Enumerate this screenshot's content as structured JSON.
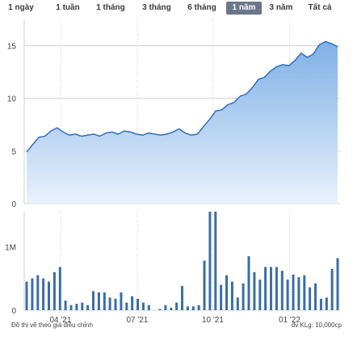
{
  "range_tabs": [
    {
      "label": "1 ngày",
      "active": false
    },
    {
      "label": "1 tuần",
      "active": false
    },
    {
      "label": "1 tháng",
      "active": false
    },
    {
      "label": "3 tháng",
      "active": false
    },
    {
      "label": "6 tháng",
      "active": false
    },
    {
      "label": "1 năm",
      "active": true
    },
    {
      "label": "3 năm",
      "active": false
    },
    {
      "label": "Tất cả",
      "active": false
    }
  ],
  "footer": {
    "left_note": "Đồ thị vẽ theo giá điều chỉnh",
    "right_note": "đv KLg: 10,000cp"
  },
  "colors": {
    "line": "#2f6fc0",
    "area_top": "#7fb0e6",
    "area_bottom": "#e9f2fc",
    "volume_bar": "#3b6ea5",
    "grid": "#d0d0d0",
    "active_tab": "#6b7688"
  },
  "chart_data": [
    {
      "type": "area",
      "x_tick_labels": [
        "04 '21",
        "07 '21",
        "10 '21",
        "01 '22"
      ],
      "y_tick_labels": [
        "0",
        "5",
        "10",
        "15"
      ],
      "ylim": [
        0,
        17.5
      ],
      "grid": true,
      "values": [
        4.9,
        5.6,
        6.3,
        6.4,
        6.9,
        7.2,
        6.8,
        6.5,
        6.6,
        6.4,
        6.5,
        6.6,
        6.4,
        6.7,
        6.8,
        6.6,
        6.9,
        6.8,
        6.6,
        6.5,
        6.7,
        6.6,
        6.5,
        6.6,
        6.8,
        7.1,
        6.7,
        6.5,
        6.6,
        7.3,
        8.0,
        8.8,
        8.9,
        9.4,
        9.6,
        10.2,
        10.4,
        11.0,
        11.8,
        12.0,
        12.6,
        13.0,
        13.2,
        13.1,
        13.6,
        14.3,
        13.9,
        14.2,
        15.1,
        15.4,
        15.2,
        14.9
      ]
    },
    {
      "type": "bar",
      "y_tick_labels": [
        "0",
        "1M"
      ],
      "ylim": [
        0,
        1.55
      ],
      "values": [
        0.45,
        0.5,
        0.55,
        0.5,
        0.45,
        0.6,
        0.68,
        0.15,
        0.08,
        0.1,
        0.12,
        0.08,
        0.3,
        0.28,
        0.28,
        0.2,
        0.18,
        0.28,
        0.12,
        0.22,
        0.18,
        0.12,
        0.08,
        0.0,
        0.02,
        0.08,
        0.04,
        0.12,
        0.38,
        0.06,
        0.06,
        0.08,
        0.78,
        1.55,
        1.55,
        0.4,
        0.55,
        0.45,
        0.2,
        0.42,
        0.85,
        0.6,
        0.48,
        0.68,
        0.68,
        0.68,
        0.62,
        0.48,
        0.56,
        0.52,
        0.55,
        0.36,
        0.42,
        0.18,
        0.2,
        0.65,
        0.82
      ]
    }
  ]
}
